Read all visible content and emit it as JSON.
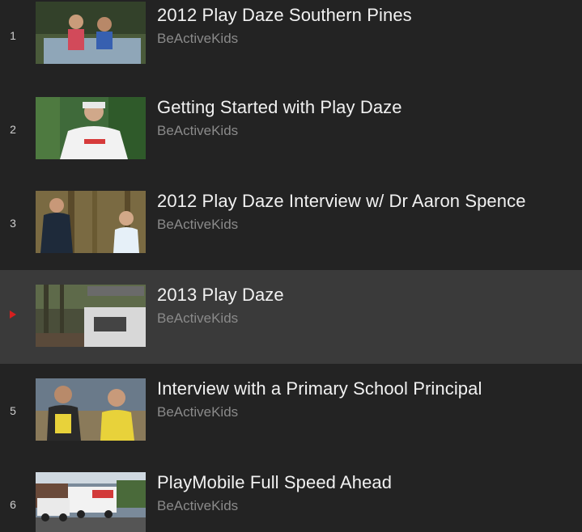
{
  "playlist": {
    "items": [
      {
        "index": "1",
        "title": "2012 Play Daze Southern Pines",
        "channel": "BeActiveKids"
      },
      {
        "index": "2",
        "title": "Getting Started with Play Daze",
        "channel": "BeActiveKids"
      },
      {
        "index": "3",
        "title": "2012 Play Daze Interview w/ Dr Aaron Spence",
        "channel": "BeActiveKids"
      },
      {
        "index": "",
        "title": "2013 Play Daze",
        "channel": "BeActiveKids",
        "now_playing": true
      },
      {
        "index": "5",
        "title": "Interview with a Primary School Principal",
        "channel": "BeActiveKids"
      },
      {
        "index": "6",
        "title": "PlayMobile Full Speed Ahead",
        "channel": "BeActiveKids"
      }
    ]
  },
  "colors": {
    "background": "#232323",
    "active_row": "#3a3a3a",
    "title": "#f1f1f1",
    "channel": "#8a8a8a",
    "now_playing_marker": "#d61f1f"
  },
  "icons": {
    "now_playing": "play-triangle-icon"
  }
}
